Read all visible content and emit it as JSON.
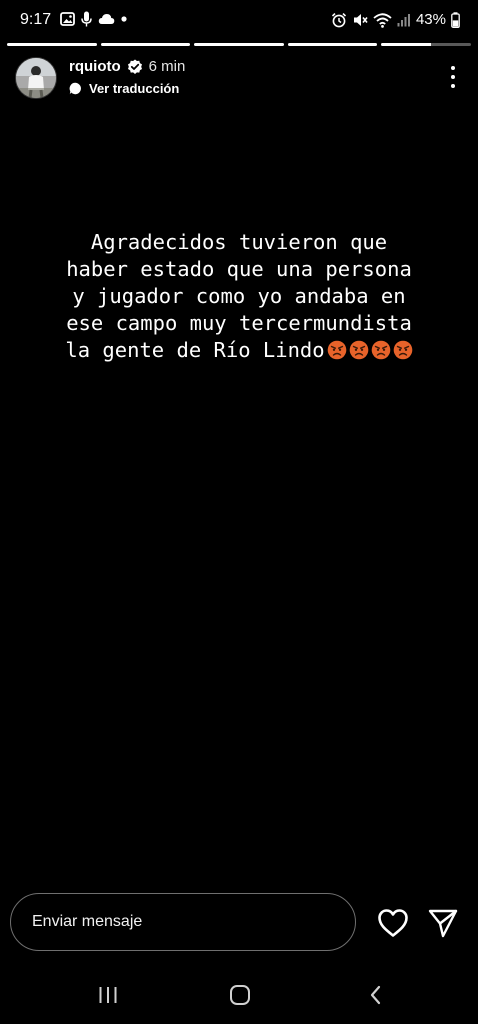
{
  "status_bar": {
    "time": "9:17",
    "battery": "43%",
    "left_icons": [
      "gallery-icon",
      "microphone-icon",
      "cloud-icon",
      "notification-dot-icon"
    ],
    "right_icons": [
      "alarm-icon",
      "mute-icon",
      "wifi-icon",
      "signal-icon",
      "battery-icon"
    ]
  },
  "story": {
    "segments_total": 5,
    "active_segment": 5,
    "active_progress": 0.55
  },
  "header": {
    "username": "rquioto",
    "verified": true,
    "time_ago": "6 min",
    "translate_label": "Ver traducción"
  },
  "content": {
    "lines": [
      "Agradecidos tuvieron que",
      "haber estado que una persona",
      "y jugador como yo andaba en",
      "ese campo muy tercermundista",
      "la gente de Río Lindo"
    ],
    "trailing_emoji": "angry-face-icon",
    "trailing_emoji_count": 4
  },
  "composer": {
    "placeholder": "Enviar mensaje"
  },
  "colors": {
    "background": "#000000",
    "text": "#ffffff",
    "composer_border": "#6f6f6f",
    "emoji_face": "#e8632a"
  }
}
